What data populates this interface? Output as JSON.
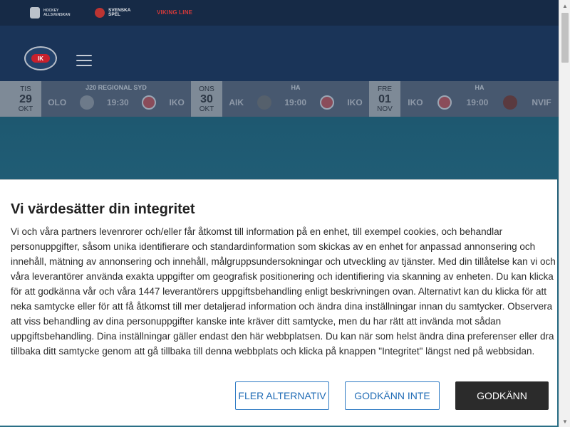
{
  "sponsors": {
    "hockeyallsvenskan": "HOCKEY ALLSVENSKAN",
    "svenskaspel": "SVENSKA SPEL",
    "vikingline": "VIKING LINE"
  },
  "header": {
    "logo_text": "IK",
    "menu_icon": "hamburger-icon"
  },
  "games": [
    {
      "dow": "TIS",
      "day": "29",
      "mon": "OKT",
      "league": "J20 REGIONAL SYD",
      "home": "OLO",
      "time": "19:30",
      "away": "IKO"
    },
    {
      "dow": "ONS",
      "day": "30",
      "mon": "OKT",
      "league": "HA",
      "home": "AIK",
      "time": "19:00",
      "away": "IKO"
    },
    {
      "dow": "FRE",
      "day": "01",
      "mon": "NOV",
      "league": "HA",
      "home": "IKO",
      "time": "19:00",
      "away": "NVIF"
    }
  ],
  "consent": {
    "title": "Vi värdesätter din integritet",
    "body": "Vi och våra partners levenrorer och/eller får åtkomst till information på en enhet, till exempel cookies, och behandlar personuppgifter, såsom unika identifierare och standardinformation som skickas av en enhet for anpassad annonsering och innehåll, mätning av annonsering och innehåll, målgruppsundersokningar och utveckling av tjänster. Med din tillåtelse kan vi och våra leverantörer använda exakta uppgifter om geografisk positionering och identifiering via skanning av enheten. Du kan klicka för att godkänna vår och våra 1447 leverantörers uppgiftsbehandling enligt beskrivningen ovan. Alternativt kan du klicka för att neka samtycke eller för att få åtkomst till mer detaljerad information och ändra dina inställningar innan du samtycker. Observera att viss behandling av dina personuppgifter kanske inte kräver ditt samtycke, men du har rätt att invända mot sådan uppgiftsbehandling. Dina inställningar gäller endast den här webbplatsen. Du kan när som helst ändra dina preferenser eller dra tillbaka ditt samtycke genom att gå tillbaka till denna webbplats och klicka på knappen \"Integritet\" längst ned på webbsidan.",
    "more_label": "FLER ALTERNATIV",
    "reject_label": "GODKÄNN INTE",
    "accept_label": "GODKÄNN"
  },
  "colors": {
    "accent": "#1f6bb5",
    "accept_bg": "#2b2b2b",
    "header_bg": "#1a3458"
  }
}
